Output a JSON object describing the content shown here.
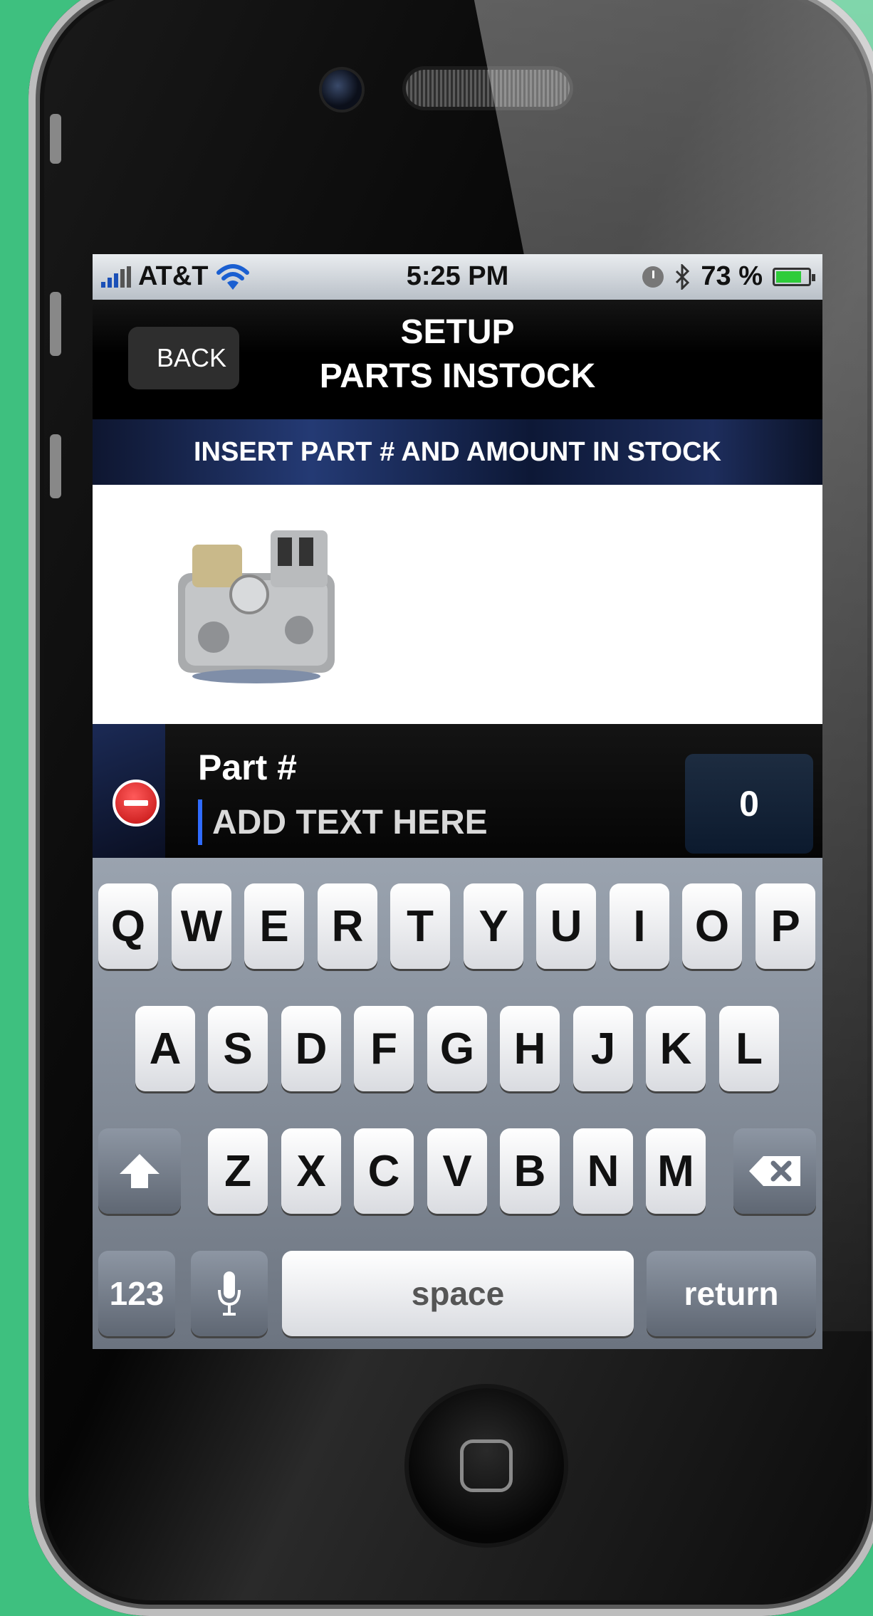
{
  "status": {
    "carrier": "AT&T",
    "time": "5:25 PM",
    "battery": "73 %"
  },
  "nav": {
    "back_label": "BACK",
    "title_line1": "SETUP",
    "title_line2": "PARTS INSTOCK"
  },
  "banner": {
    "text": "INSERT PART # AND AMOUNT IN STOCK"
  },
  "part": {
    "label": "Part #",
    "placeholder": "ADD TEXT HERE",
    "value": "",
    "quantity": "0"
  },
  "keyboard": {
    "row1": [
      "Q",
      "W",
      "E",
      "R",
      "T",
      "Y",
      "U",
      "I",
      "O",
      "P"
    ],
    "row2": [
      "A",
      "S",
      "D",
      "F",
      "G",
      "H",
      "J",
      "K",
      "L"
    ],
    "row3": [
      "Z",
      "X",
      "C",
      "V",
      "B",
      "N",
      "M"
    ],
    "numbers_label": "123",
    "space_label": "space",
    "return_label": "return"
  },
  "icons": [
    "signal-bars-icon",
    "wifi-icon",
    "alarm-clock-icon",
    "bluetooth-icon",
    "battery-icon",
    "delete-row-icon",
    "shift-icon",
    "backspace-icon",
    "microphone-icon"
  ]
}
